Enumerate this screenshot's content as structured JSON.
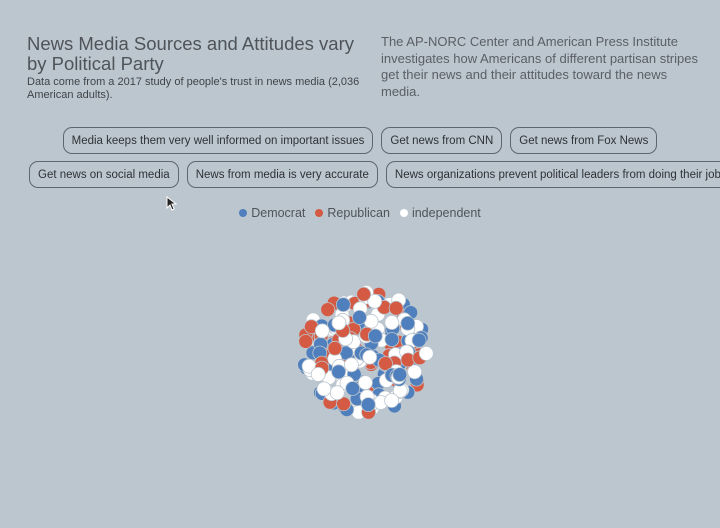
{
  "header": {
    "title": "News Media Sources and Attitudes vary by Political Party",
    "subtitle": "Data come from a 2017 study of people's trust in news media (2,036 American adults).",
    "intro": "The AP-NORC Center and American Press Institute investigates how Americans of different partisan stripes get their news and their attitudes toward the news media."
  },
  "filters": {
    "row1": [
      {
        "label": "Media keeps them very well informed on important issues"
      },
      {
        "label": "Get news from CNN"
      },
      {
        "label": "Get news from Fox News"
      }
    ],
    "row2": [
      {
        "label": "Get news on social media"
      },
      {
        "label": "News from media is very accurate"
      },
      {
        "label": "News organizations prevent political leaders from doing their job"
      }
    ]
  },
  "legend": [
    {
      "label": "Democrat",
      "color": "#4f7fbc"
    },
    {
      "label": "Republican",
      "color": "#d45a43"
    },
    {
      "label": "independent",
      "color": "#ffffff"
    }
  ],
  "colors": {
    "background": "#bcc6cf",
    "democrat": "#4f7fbc",
    "republican": "#d45a43",
    "independent": "#ffffff"
  }
}
